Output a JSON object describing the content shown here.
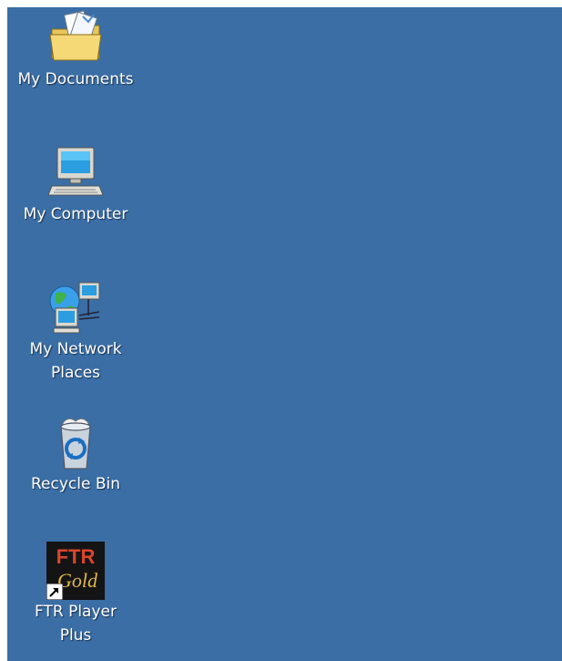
{
  "desktop": {
    "background_color": "#3a6ea5",
    "icons": [
      {
        "label": "My Documents",
        "icon": "my-documents-icon"
      },
      {
        "label": "My Computer",
        "icon": "my-computer-icon"
      },
      {
        "label": "My Network\nPlaces",
        "icon": "my-network-places-icon"
      },
      {
        "label": "Recycle Bin",
        "icon": "recycle-bin-icon"
      },
      {
        "label": "FTR Player\nPlus",
        "icon": "ftr-player-plus-icon",
        "logo_text": "FTR Gold",
        "shortcut": true
      }
    ]
  }
}
